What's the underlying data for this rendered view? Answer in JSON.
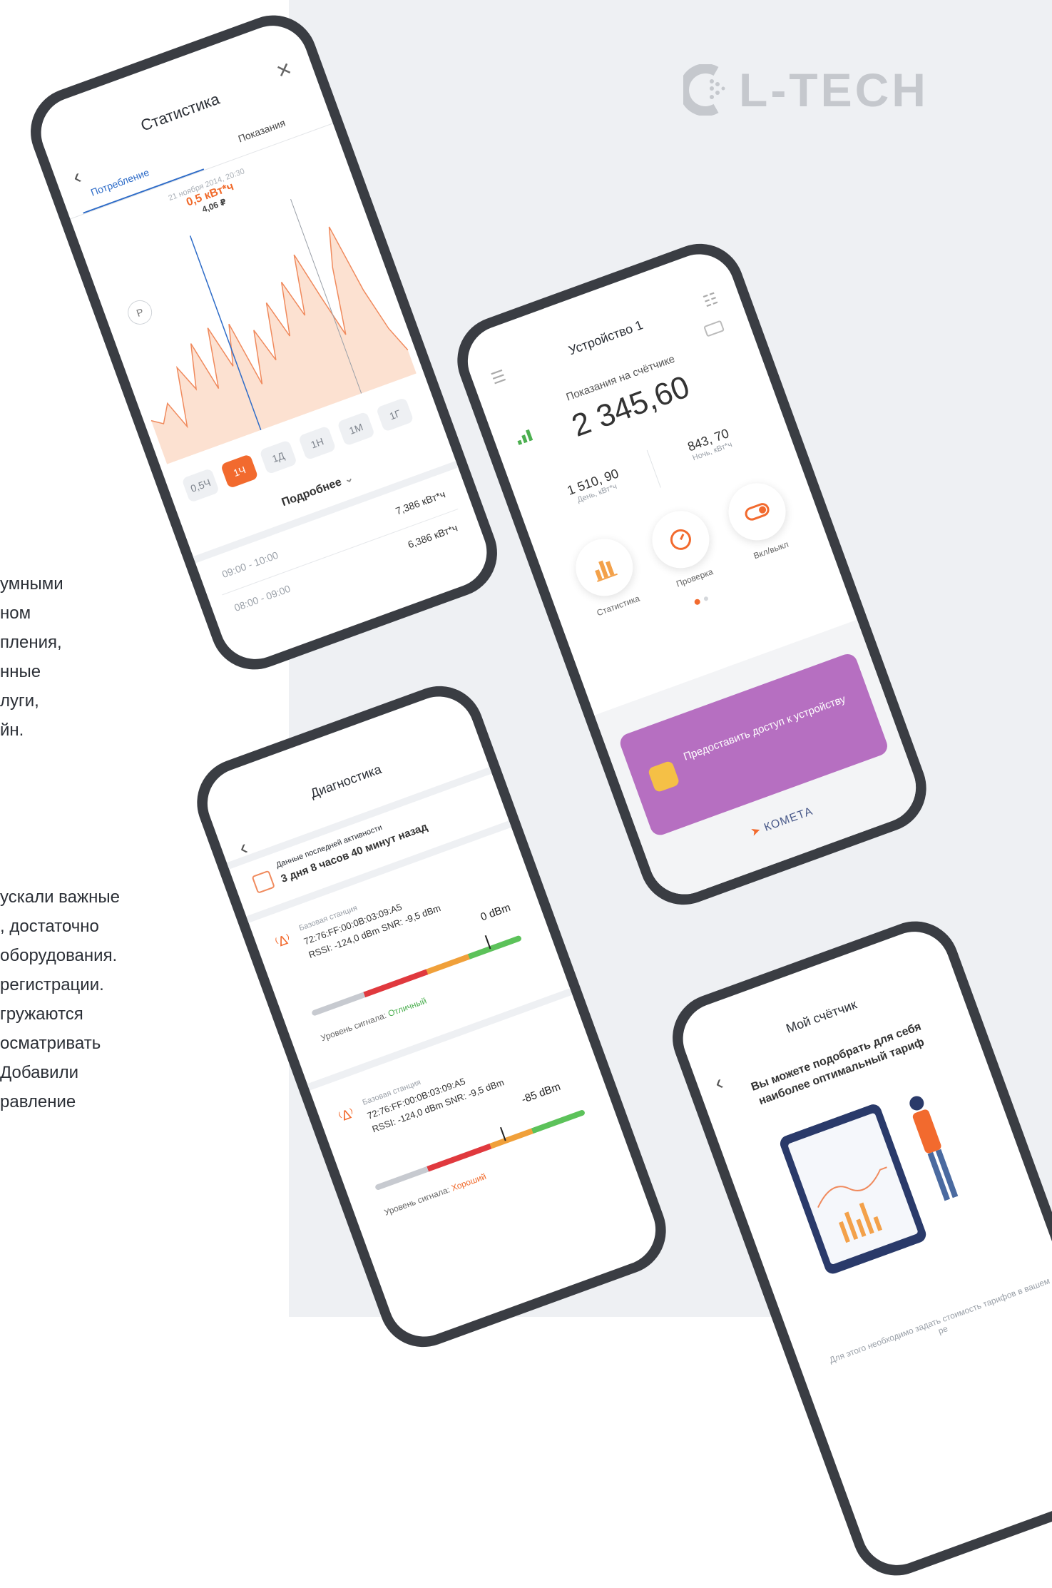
{
  "brand": {
    "name": "L-TECH"
  },
  "left_text": {
    "block1": [
      "умными",
      "ном",
      "пления,",
      "нные",
      "луги,",
      "йн."
    ],
    "block2": [
      "ускали важные",
      ", достаточно",
      "оборудования.",
      "регистрации.",
      "гружаются",
      "осматривать",
      "Добавили",
      "равление"
    ]
  },
  "stats": {
    "title": "Статистика",
    "tabs": [
      "Потребление",
      "Показания"
    ],
    "tooltip": {
      "date": "21 ноября 2014, 20:30",
      "value": "0,5 кВт*ч",
      "cost": "4,06 ₽"
    },
    "currency_badge": "Р",
    "range_chips": [
      "0,5Ч",
      "1Ч",
      "1Д",
      "1Н",
      "1М",
      "1Г"
    ],
    "active_chip": "1Ч",
    "more_label": "Подробнее",
    "rows": [
      {
        "time": "09:00 - 10:00",
        "value": "7,386 кВт*ч"
      },
      {
        "time": "08:00 - 09:00",
        "value": "6,386 кВт*ч"
      }
    ]
  },
  "chart_data": {
    "type": "area",
    "values": [
      0.22,
      0.18,
      0.28,
      0.12,
      0.45,
      0.3,
      0.55,
      0.26,
      0.6,
      0.35,
      0.58,
      0.2,
      0.5,
      0.3,
      0.62,
      0.4,
      0.7,
      0.48,
      0.82,
      0.55,
      0.3,
      0.68,
      0.9,
      0.5,
      0.25,
      0.1
    ],
    "colors": {
      "line": "#f08a5d",
      "fill": "#fbd9c6"
    }
  },
  "device": {
    "title": "Устройство 1",
    "readings_label": "Показания на счётчике",
    "total": "2 345,60",
    "day_value": "1 510, 90",
    "day_label": "День, кВт*ч",
    "night_value": "843, 70",
    "night_label": "Ночь, кВт*ч",
    "actions": [
      "Статистика",
      "Проверка",
      "Вкл/выкл"
    ],
    "access_banner": "Предоставить доступ к устройству",
    "footer_brand": "КОМЕТА",
    "colors": {
      "banner": "#b66fc1",
      "accent": "#f26a2e",
      "signal": "#4caf50"
    }
  },
  "diag": {
    "title": "Диагностика",
    "last_activity_label": "Данные последней активности",
    "last_activity_value": "3 дня 8 часов 40 минут назад",
    "stations": [
      {
        "label": "Базовая станция",
        "mac": "72:76:FF:00:0B:03:09:A5",
        "rssi": "RSSI: -124,0 dBm  SNR: -9,5 dBm",
        "dbm": "0 dBm",
        "level_label": "Уровень сигнала:",
        "level_value": "Отличный",
        "level_fraction": 0.85
      },
      {
        "label": "Базовая станция",
        "mac": "72:76:FF:00:0B:03:09:A5",
        "rssi": "RSSI: -124,0 dBm  SNR: -9,5 dBm",
        "dbm": "-85 dBm",
        "level_label": "Уровень сигнала:",
        "level_value": "Хороший",
        "level_fraction": 0.62
      }
    ]
  },
  "meter": {
    "title": "Мой счётчик",
    "heading": "Вы можете подобрать для себя наиболее оптимальный тариф",
    "note": "Для этого необходимо задать стоимость тарифов в вашем ре"
  }
}
